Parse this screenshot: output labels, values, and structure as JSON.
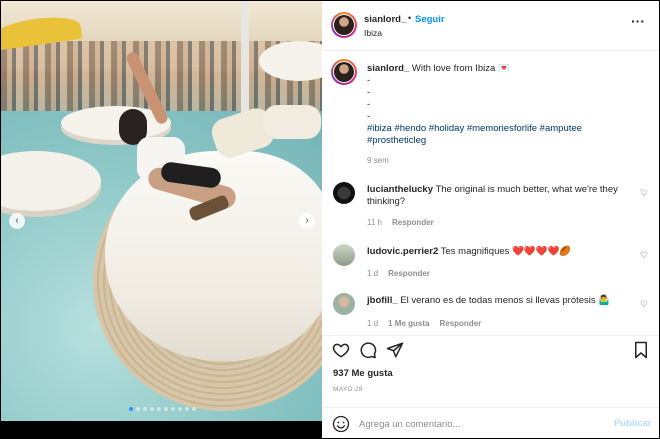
{
  "post": {
    "username": "sianlord_",
    "follow_label": "Seguir",
    "bullet": "•",
    "location": "Ibiza",
    "more_label": "···",
    "caption": {
      "username": "sianlord_",
      "text": "With love from Ibiza 💌",
      "dash_lines": [
        "-",
        "-",
        "-",
        "-"
      ],
      "hashtags_line1": "#ibiza #hendo #holiday #memoriesforlife #amputee",
      "hashtags_line2": "#prostheticleg",
      "time": "9 sem"
    },
    "comments": [
      {
        "username": "lucianthelucky",
        "text": "The original is much better, what we're they thinking?",
        "time": "11 h",
        "reply_label": "Responder"
      },
      {
        "username": "ludovic.perrier2",
        "text": "Tes magnifiques ❤️❤️❤️❤️🏉",
        "time": "1 d",
        "reply_label": "Responder"
      },
      {
        "username": "jbofill_",
        "text": "El verano es de todas menos si llevas prótesis 🤷‍♂️",
        "time": "1 d",
        "likes_label": "1 Me gusta",
        "reply_label": "Responder"
      }
    ],
    "likes": "937 Me gusta",
    "date": "MAYO 28",
    "comment_placeholder": "Agrega un comentario...",
    "publish_label": "Publicar",
    "carousel": {
      "total": 10,
      "active_index": 0
    }
  },
  "colors": {
    "link_blue": "#0095f6",
    "hashtag": "#00376b",
    "muted": "#8e8e8e",
    "publish_disabled": "#b3dbff"
  }
}
